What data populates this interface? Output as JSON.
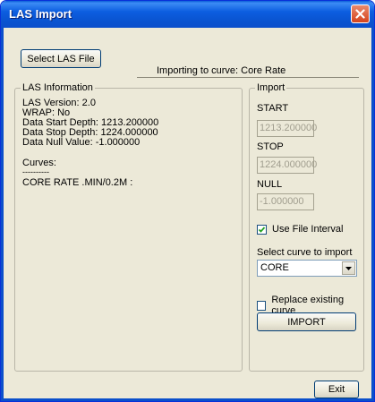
{
  "window": {
    "title": "LAS Import"
  },
  "toolbar": {
    "select_file_label": "Select LAS File",
    "status_text": "Importing to curve: Core Rate"
  },
  "info": {
    "legend": "LAS Information",
    "lines": [
      "LAS Version: 2.0",
      "WRAP: No",
      "Data Start Depth: 1213.200000",
      "Data Stop Depth: 1224.000000",
      "Data Null Value: -1.000000"
    ],
    "curves_label": "Curves:",
    "curves_separator": "----------",
    "curve_entry": "CORE RATE .MIN/0.2M :"
  },
  "import": {
    "legend": "Import",
    "start_label": "START",
    "start_value": "1213.200000",
    "stop_label": "STOP",
    "stop_value": "1224.000000",
    "null_label": "NULL",
    "null_value": "-1.000000",
    "use_file_interval_label": "Use File Interval",
    "use_file_interval_checked": true,
    "select_curve_label": "Select curve to import",
    "selected_curve": "CORE",
    "replace_label": "Replace existing curve",
    "replace_checked": false,
    "import_button_label": "IMPORT"
  },
  "footer": {
    "exit_label": "Exit"
  },
  "colors": {
    "title_bar": "#0a55d2",
    "close_button": "#d5431d",
    "dialog_bg": "#ece9d8"
  },
  "icons": {
    "close": "close-icon",
    "check": "check-icon",
    "dropdown": "chevron-down-icon"
  }
}
